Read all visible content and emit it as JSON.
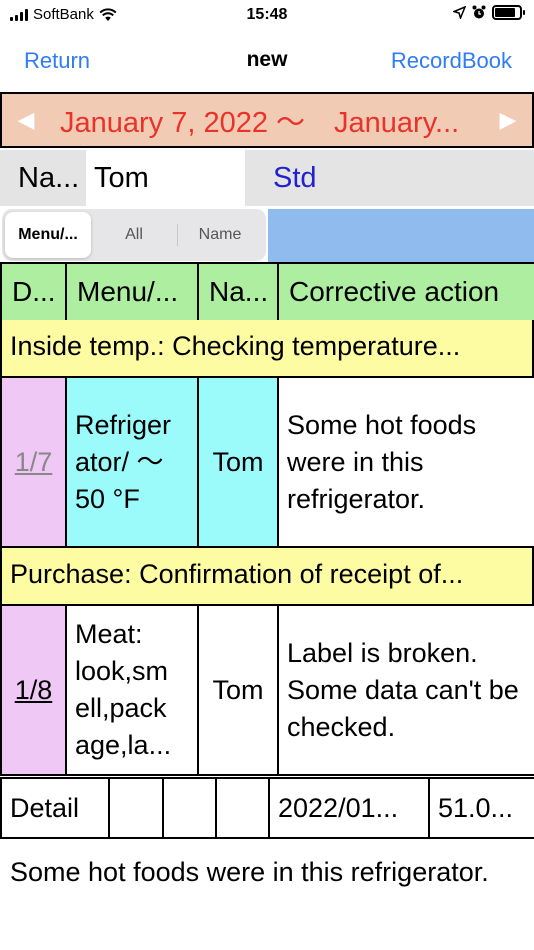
{
  "status_bar": {
    "carrier": "SoftBank",
    "time": "15:48",
    "battery_level": 0.85
  },
  "nav": {
    "back_label": "Return",
    "title": "new",
    "right_label": "RecordBook"
  },
  "date_range": {
    "prev_arrow": "◀",
    "text": "January 7, 2022 ～　January...",
    "next_arrow": "▶"
  },
  "filter": {
    "name_label": "Na...",
    "name_value": "Tom",
    "std_label": "Std"
  },
  "segments": {
    "options": [
      "Menu/...",
      "All",
      "Name"
    ],
    "selected": "Menu/..."
  },
  "table": {
    "headers": [
      "D...",
      "Menu/...",
      "Na...",
      "Corrective action"
    ],
    "groups": [
      {
        "title": "Inside temp.: Checking temperature...",
        "rows": [
          {
            "date": "1/7",
            "menu": "Refriger ator/ ～ 50 °F",
            "name": "Tom",
            "action": "Some hot foods were in this refrigerator."
          }
        ]
      },
      {
        "title": "Purchase: Confirmation of receipt of...",
        "rows": [
          {
            "date": "1/8",
            "menu": "Meat: look,sm ell,pack age,la...",
            "name": "Tom",
            "action": "Label is broken. Some data can't be checked."
          }
        ]
      }
    ]
  },
  "detail": {
    "label": "Detail",
    "date": "2022/01...",
    "value": "51.0..."
  },
  "comment": "Some hot foods were in this refrigerator.",
  "colors": {
    "link_blue": "#2f7cf6",
    "date_bar_bg": "#f2cbb4",
    "date_text": "#e8322a",
    "header_green": "#adeea0",
    "group_yellow": "#fdfca3",
    "date_pink": "#f0c8f5",
    "cell_cyan": "#9bfbfb",
    "std_blue": "#2222cc",
    "panel_blue": "#8fbbee"
  }
}
